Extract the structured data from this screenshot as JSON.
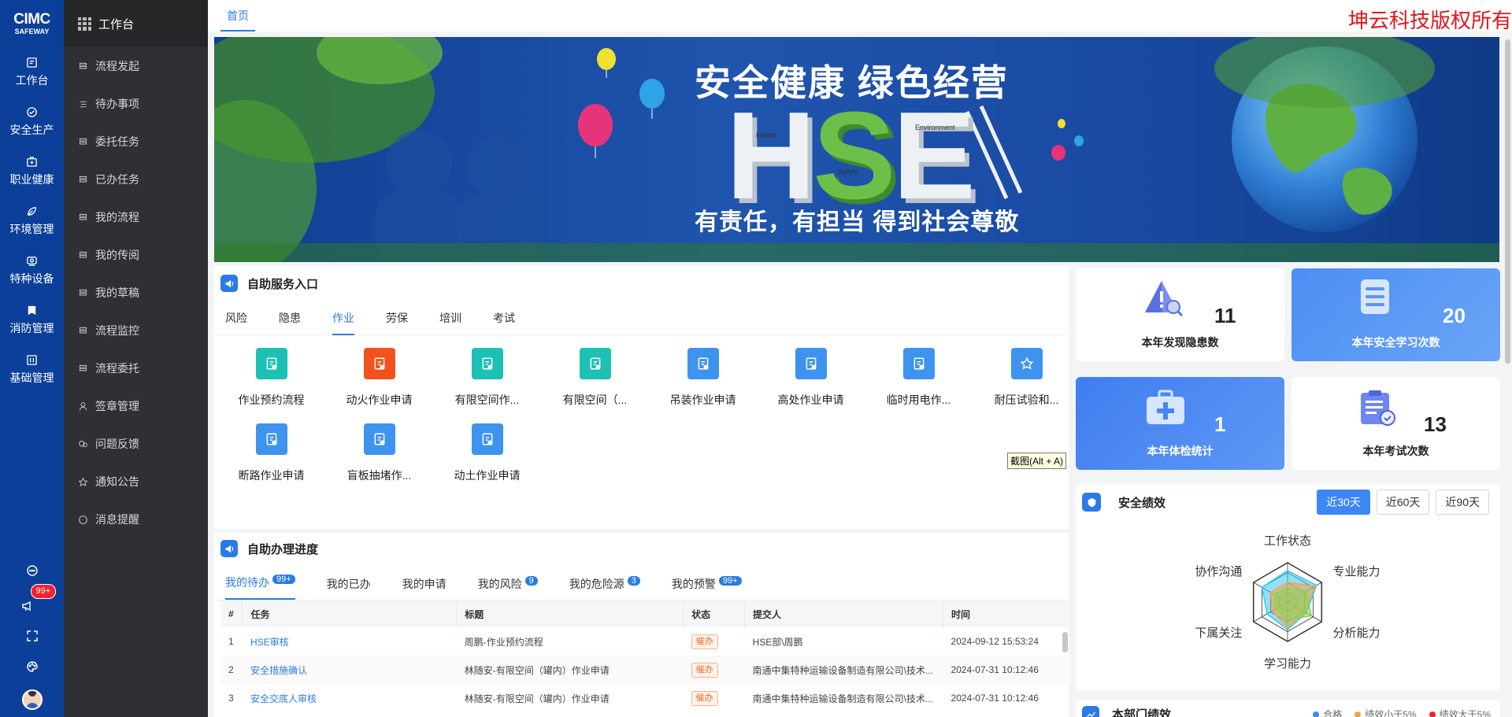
{
  "rail": {
    "logo_top": "CIMC",
    "logo_bottom": "SAFEWAY",
    "items": [
      {
        "label": "工作台",
        "icon": "workbench-icon"
      },
      {
        "label": "安全生产",
        "icon": "shield-check-icon"
      },
      {
        "label": "职业健康",
        "icon": "medical-kit-icon"
      },
      {
        "label": "环境管理",
        "icon": "leaf-icon"
      },
      {
        "label": "特种设备",
        "icon": "equipment-icon"
      },
      {
        "label": "消防管理",
        "icon": "fire-icon"
      },
      {
        "label": "基础管理",
        "icon": "database-icon"
      }
    ],
    "notify_badge": "99+"
  },
  "sidebar": {
    "header": "工作台",
    "items": [
      {
        "label": "流程发起"
      },
      {
        "label": "待办事项"
      },
      {
        "label": "委托任务"
      },
      {
        "label": "已办任务"
      },
      {
        "label": "我的流程"
      },
      {
        "label": "我的传阅"
      },
      {
        "label": "我的草稿"
      },
      {
        "label": "流程监控"
      },
      {
        "label": "流程委托"
      },
      {
        "label": "签章管理"
      },
      {
        "label": "问题反馈"
      },
      {
        "label": "通知公告"
      },
      {
        "label": "消息提醒"
      }
    ]
  },
  "top": {
    "home_tab": "首页",
    "copyright": "坤云科技版权所有"
  },
  "banner": {
    "slogan1": "安全健康  绿色经营",
    "hse_h": "H",
    "hse_s": "S",
    "hse_e": "E",
    "slogan2": "有责任，有担当   得到社会尊敬",
    "word_health": "Health",
    "word_safety": "Safety",
    "word_environment": "Environment"
  },
  "self_service": {
    "title": "自助服务入口",
    "tabs": [
      "风险",
      "隐患",
      "作业",
      "劳保",
      "培训",
      "考试"
    ],
    "active_tab": 2,
    "items": [
      {
        "label": "作业预约流程",
        "color": "#1cc0b4"
      },
      {
        "label": "动火作业申请",
        "color": "#f2521c"
      },
      {
        "label": "有限空间作...",
        "color": "#1cc0b4"
      },
      {
        "label": "有限空间（...",
        "color": "#1cc0b4"
      },
      {
        "label": "吊装作业申请",
        "color": "#3e93ef"
      },
      {
        "label": "高处作业申请",
        "color": "#3e93ef"
      },
      {
        "label": "临时用电作...",
        "color": "#3e93ef"
      },
      {
        "label": "耐压试验和...",
        "color": "#3e93ef"
      },
      {
        "label": "断路作业申请",
        "color": "#3e93ef"
      },
      {
        "label": "盲板抽堵作...",
        "color": "#3e93ef"
      },
      {
        "label": "动土作业申请",
        "color": "#3e93ef"
      }
    ],
    "tooltip": "截图(Alt + A)"
  },
  "progress": {
    "title": "自助办理进度",
    "tabs": [
      {
        "label": "我的待办",
        "count": "99+"
      },
      {
        "label": "我的已办",
        "count": ""
      },
      {
        "label": "我的申请",
        "count": ""
      },
      {
        "label": "我的风险",
        "count": "9"
      },
      {
        "label": "我的危险源",
        "count": "3"
      },
      {
        "label": "我的预警",
        "count": "99+"
      }
    ],
    "columns": [
      "#",
      "任务",
      "标题",
      "状态",
      "提交人",
      "时间"
    ],
    "rows": [
      {
        "no": "1",
        "task": "HSE审核",
        "title": "周鹏-作业预约流程",
        "status": "催办",
        "submitter": "HSE部\\周鹏",
        "time": "2024-09-12 15:53:24"
      },
      {
        "no": "2",
        "task": "安全措施确认",
        "title": "林随安-有限空间（罐内）作业申请",
        "status": "催办",
        "submitter": "南通中集特种运输设备制造有限公司\\技术...",
        "time": "2024-07-31 10:12:46"
      },
      {
        "no": "3",
        "task": "安全交底人审核",
        "title": "林随安-有限空间（罐内）作业申请",
        "status": "催办",
        "submitter": "南通中集特种运输设备制造有限公司\\技术...",
        "time": "2024-07-31 10:12:46"
      }
    ]
  },
  "stats": [
    {
      "label": "本年发现隐患数",
      "value": "11",
      "icon": "warning-search-icon"
    },
    {
      "label": "本年安全学习次数",
      "value": "20",
      "icon": "document-list-icon"
    },
    {
      "label": "本年体检统计",
      "value": "1",
      "icon": "medical-box-icon"
    },
    {
      "label": "本年考试次数",
      "value": "13",
      "icon": "exam-clipboard-icon"
    }
  ],
  "performance": {
    "title": "安全绩效",
    "ranges": [
      "近30天",
      "近60天",
      "近90天"
    ],
    "active_range": 0,
    "radar": {
      "type": "radar",
      "axes": [
        "工作状态",
        "专业能力",
        "分析能力",
        "学习能力",
        "下属关注",
        "协作沟通"
      ],
      "series": [
        {
          "values": [
            0.8,
            0.85,
            0.55,
            0.7,
            0.6,
            0.75
          ],
          "color": "#37c7f0"
        },
        {
          "values": [
            0.5,
            0.8,
            0.5,
            0.65,
            0.45,
            0.5
          ],
          "color": "#f0a640"
        },
        {
          "values": [
            0.35,
            0.55,
            0.7,
            0.45,
            0.35,
            0.4
          ],
          "color": "#8fd14f"
        }
      ],
      "max": 1
    }
  },
  "dept_perf": {
    "title": "本部门绩效",
    "legend": [
      "合格",
      "绩效小于5%",
      "绩效大于5%"
    ]
  }
}
